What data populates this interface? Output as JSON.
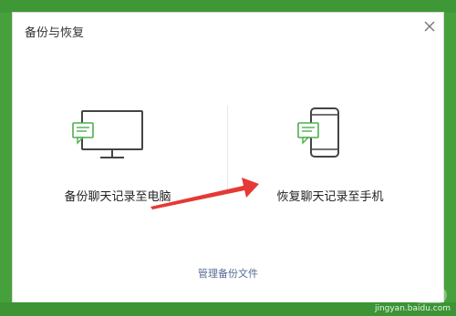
{
  "dialog": {
    "title": "备份与恢复",
    "close_icon": "close-icon"
  },
  "options": [
    {
      "icon": "monitor-chat-icon",
      "label": "备份聊天记录至电脑"
    },
    {
      "icon": "phone-chat-icon",
      "label": "恢复聊天记录至手机"
    }
  ],
  "footer": {
    "manage_link": "管理备份文件"
  },
  "watermark": {
    "site": "jingyan.baidu.com"
  },
  "colors": {
    "background": "#46a13c",
    "accent_green": "#4caf50",
    "arrow_red": "#e53935",
    "link": "#576b95"
  }
}
